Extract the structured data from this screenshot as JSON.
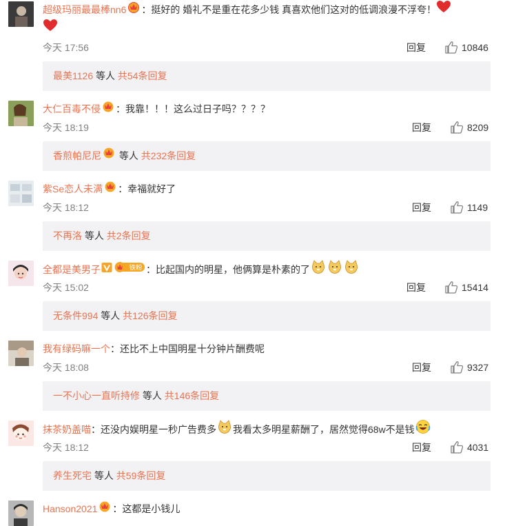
{
  "comments": [
    {
      "user": "超级玛丽最最棒nn6",
      "sep": "：",
      "text": "挺好的 婚礼不是重在花多少钱 真喜欢他们这对的低调浪漫不浮夸！",
      "time": "今天 17:56",
      "reply_label": "回复",
      "likes": "10846",
      "sub_user": "最美1126",
      "sub_mid": " 等人 ",
      "sub_total": "共54条回复"
    },
    {
      "user": "大仁百毒不侵",
      "sep": "：",
      "text": "我靠！！！这么过日子吗？？？？",
      "time": "今天 18:19",
      "reply_label": "回复",
      "likes": "8209",
      "sub_user": "香煎帕尼尼",
      "sub_mid": " 等人 ",
      "sub_total": "共232条回复"
    },
    {
      "user": "紫Se恋人未满",
      "sep": "：",
      "text": "幸福就好了",
      "time": "今天 18:12",
      "reply_label": "回复",
      "likes": "1149",
      "sub_user": "不再洛",
      "sub_mid": " 等人 ",
      "sub_total": "共2条回复"
    },
    {
      "user": "全都是美男子",
      "fan_badge": "铁粉",
      "sep": "：",
      "text": "比起国内的明星，他俩算是朴素的了",
      "time": "今天 15:02",
      "reply_label": "回复",
      "likes": "15414",
      "sub_user": "无条件994",
      "sub_mid": " 等人 ",
      "sub_total": "共126条回复"
    },
    {
      "user": "我有绿码嘛一个",
      "sep": "：",
      "text": "还比不上中国明星十分钟片酬费呢",
      "time": "今天 18:08",
      "reply_label": "回复",
      "likes": "9327",
      "sub_user": "一不小心一直听持修",
      "sub_mid": " 等人 ",
      "sub_total": "共146条回复"
    },
    {
      "user": "抹茶奶盖喵",
      "sep": "：",
      "text": "还没内娱明星一秒广告费多",
      "text2": "我看太多明星薪酬了，居然觉得68w不是钱",
      "time": "今天 18:12",
      "reply_label": "回复",
      "likes": "4031",
      "sub_user": "养生死宅",
      "sub_mid": " 等人 ",
      "sub_total": "共59条回复"
    },
    {
      "user": "Hanson2021",
      "sep": "：",
      "text": "这都是小钱儿"
    }
  ],
  "colors": {
    "link": "#eb7350",
    "sub_bg": "#f2f2f5",
    "text": "#333333",
    "muted": "#808080"
  }
}
